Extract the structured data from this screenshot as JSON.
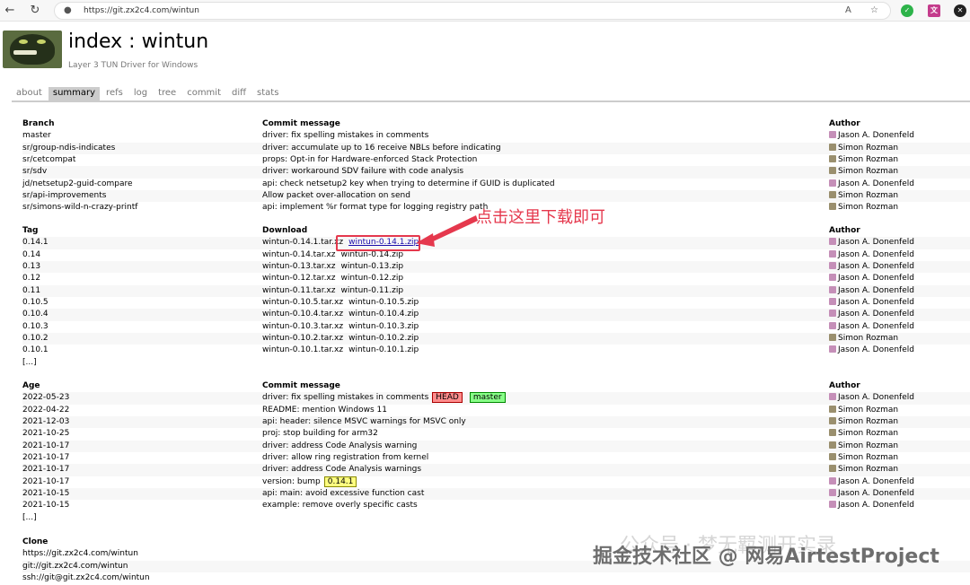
{
  "browser": {
    "url": "https://git.zx2c4.com/wintun",
    "back_icon": "←",
    "refresh_icon": "↻",
    "lock_icon": "🔒",
    "read_aloud": "A",
    "favorite": "☆"
  },
  "header": {
    "title": "index : wintun",
    "subtitle": "Layer 3 TUN Driver for Windows"
  },
  "tabs": [
    "about",
    "summary",
    "refs",
    "log",
    "tree",
    "commit",
    "diff",
    "stats"
  ],
  "active_tab": "summary",
  "branches": {
    "headers": [
      "Branch",
      "Commit message",
      "Author"
    ],
    "rows": [
      [
        "master",
        "driver: fix spelling mistakes in comments",
        "Jason A. Donenfeld"
      ],
      [
        "sr/group-ndis-indicates",
        "driver: accumulate up to 16 receive NBLs before indicating",
        "Simon Rozman"
      ],
      [
        "sr/cetcompat",
        "props: Opt-in for Hardware-enforced Stack Protection",
        "Simon Rozman"
      ],
      [
        "sr/sdv",
        "driver: workaround SDV failure with code analysis",
        "Simon Rozman"
      ],
      [
        "jd/netsetup2-guid-compare",
        "api: check netsetup2 key when trying to determine if GUID is duplicated",
        "Jason A. Donenfeld"
      ],
      [
        "sr/api-improvements",
        "Allow packet over-allocation on send",
        "Simon Rozman"
      ],
      [
        "sr/simons-wild-n-crazy-printf",
        "api: implement %r format type for logging registry path",
        "Simon Rozman"
      ]
    ]
  },
  "tags": {
    "headers": [
      "Tag",
      "Download",
      "Author"
    ],
    "rows": [
      [
        "0.14.1",
        "wintun-0.14.1.tar.xz",
        "wintun-0.14.1.zip",
        "Jason A. Donenfeld"
      ],
      [
        "0.14",
        "wintun-0.14.tar.xz",
        "wintun-0.14.zip",
        "Jason A. Donenfeld"
      ],
      [
        "0.13",
        "wintun-0.13.tar.xz",
        "wintun-0.13.zip",
        "Jason A. Donenfeld"
      ],
      [
        "0.12",
        "wintun-0.12.tar.xz",
        "wintun-0.12.zip",
        "Jason A. Donenfeld"
      ],
      [
        "0.11",
        "wintun-0.11.tar.xz",
        "wintun-0.11.zip",
        "Jason A. Donenfeld"
      ],
      [
        "0.10.5",
        "wintun-0.10.5.tar.xz",
        "wintun-0.10.5.zip",
        "Jason A. Donenfeld"
      ],
      [
        "0.10.4",
        "wintun-0.10.4.tar.xz",
        "wintun-0.10.4.zip",
        "Jason A. Donenfeld"
      ],
      [
        "0.10.3",
        "wintun-0.10.3.tar.xz",
        "wintun-0.10.3.zip",
        "Jason A. Donenfeld"
      ],
      [
        "0.10.2",
        "wintun-0.10.2.tar.xz",
        "wintun-0.10.2.zip",
        "Simon Rozman"
      ],
      [
        "0.10.1",
        "wintun-0.10.1.tar.xz",
        "wintun-0.10.1.zip",
        "Jason A. Donenfeld"
      ]
    ],
    "more": "[...]"
  },
  "log": {
    "headers": [
      "Age",
      "Commit message",
      "Author"
    ],
    "rows": [
      [
        "2022-05-23",
        "driver: fix spelling mistakes in comments",
        "Jason A. Donenfeld"
      ],
      [
        "2022-04-22",
        "README: mention Windows 11",
        "Simon Rozman"
      ],
      [
        "2021-12-03",
        "api: header: silence MSVC warnings for MSVC only",
        "Simon Rozman"
      ],
      [
        "2021-10-25",
        "proj: stop building for arm32",
        "Simon Rozman"
      ],
      [
        "2021-10-17",
        "driver: address Code Analysis warning",
        "Simon Rozman"
      ],
      [
        "2021-10-17",
        "driver: allow ring registration from kernel",
        "Simon Rozman"
      ],
      [
        "2021-10-17",
        "driver: address Code Analysis warnings",
        "Simon Rozman"
      ],
      [
        "2021-10-17",
        "version: bump",
        "Jason A. Donenfeld"
      ],
      [
        "2021-10-15",
        "api: main: avoid excessive function cast",
        "Jason A. Donenfeld"
      ],
      [
        "2021-10-15",
        "example: remove overly specific casts",
        "Jason A. Donenfeld"
      ]
    ],
    "more": "[...]",
    "badges": {
      "head": "HEAD",
      "master": "master",
      "tag": "0.14.1"
    }
  },
  "clone": {
    "header": "Clone",
    "urls": [
      "https://git.zx2c4.com/wintun",
      "git://git.zx2c4.com/wintun",
      "ssh://git@git.zx2c4.com/wintun"
    ]
  },
  "annotation": "点击这里下载即可",
  "watermark": "掘金技术社区 @ 网易AirtestProject",
  "watermark_bg": "公众号 · 梦无羁测开实录",
  "colors": {
    "annotation": "#e5384d",
    "active_tab": "#cccccc",
    "jason_avatar": "#c58fb8",
    "simon_avatar": "#9a8f6e"
  }
}
